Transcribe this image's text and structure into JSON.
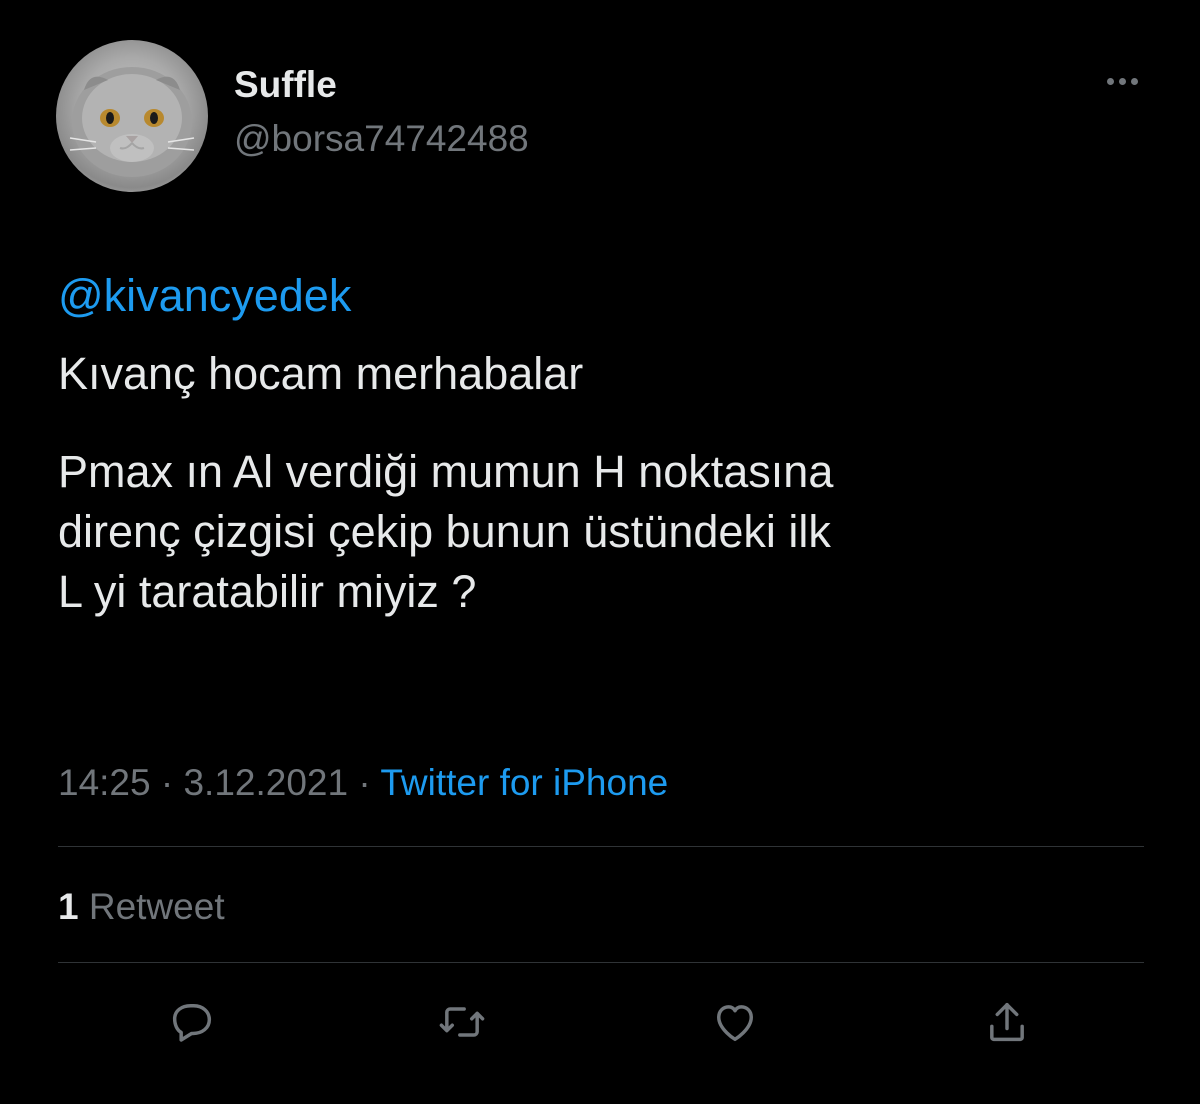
{
  "tweet": {
    "author": {
      "display_name": "Suffle",
      "handle": "@borsa74742488",
      "avatar": "cat-avatar"
    },
    "more_icon": "more-horizontal-icon",
    "mention": "@kivancyedek",
    "line1": "Kıvanç hocam merhabalar",
    "paragraph": "Pmax ın Al verdiği mumun H noktasına\ndirenç çizgisi çekip bunun üstündeki ilk\nL yi taratabilir miyiz ?",
    "time": "14:25",
    "date": "3.12.2021",
    "separator": "·",
    "source": "Twitter for iPhone",
    "stats": {
      "retweet_count": "1",
      "retweet_label": "Retweet"
    },
    "actions": {
      "reply_icon": "reply-icon",
      "retweet_icon": "retweet-icon",
      "like_icon": "heart-icon",
      "share_icon": "share-icon"
    },
    "colors": {
      "background": "#000000",
      "text": "#e7e9ea",
      "muted": "#71767b",
      "link": "#1d9bf0",
      "divider": "#2f3336"
    }
  }
}
